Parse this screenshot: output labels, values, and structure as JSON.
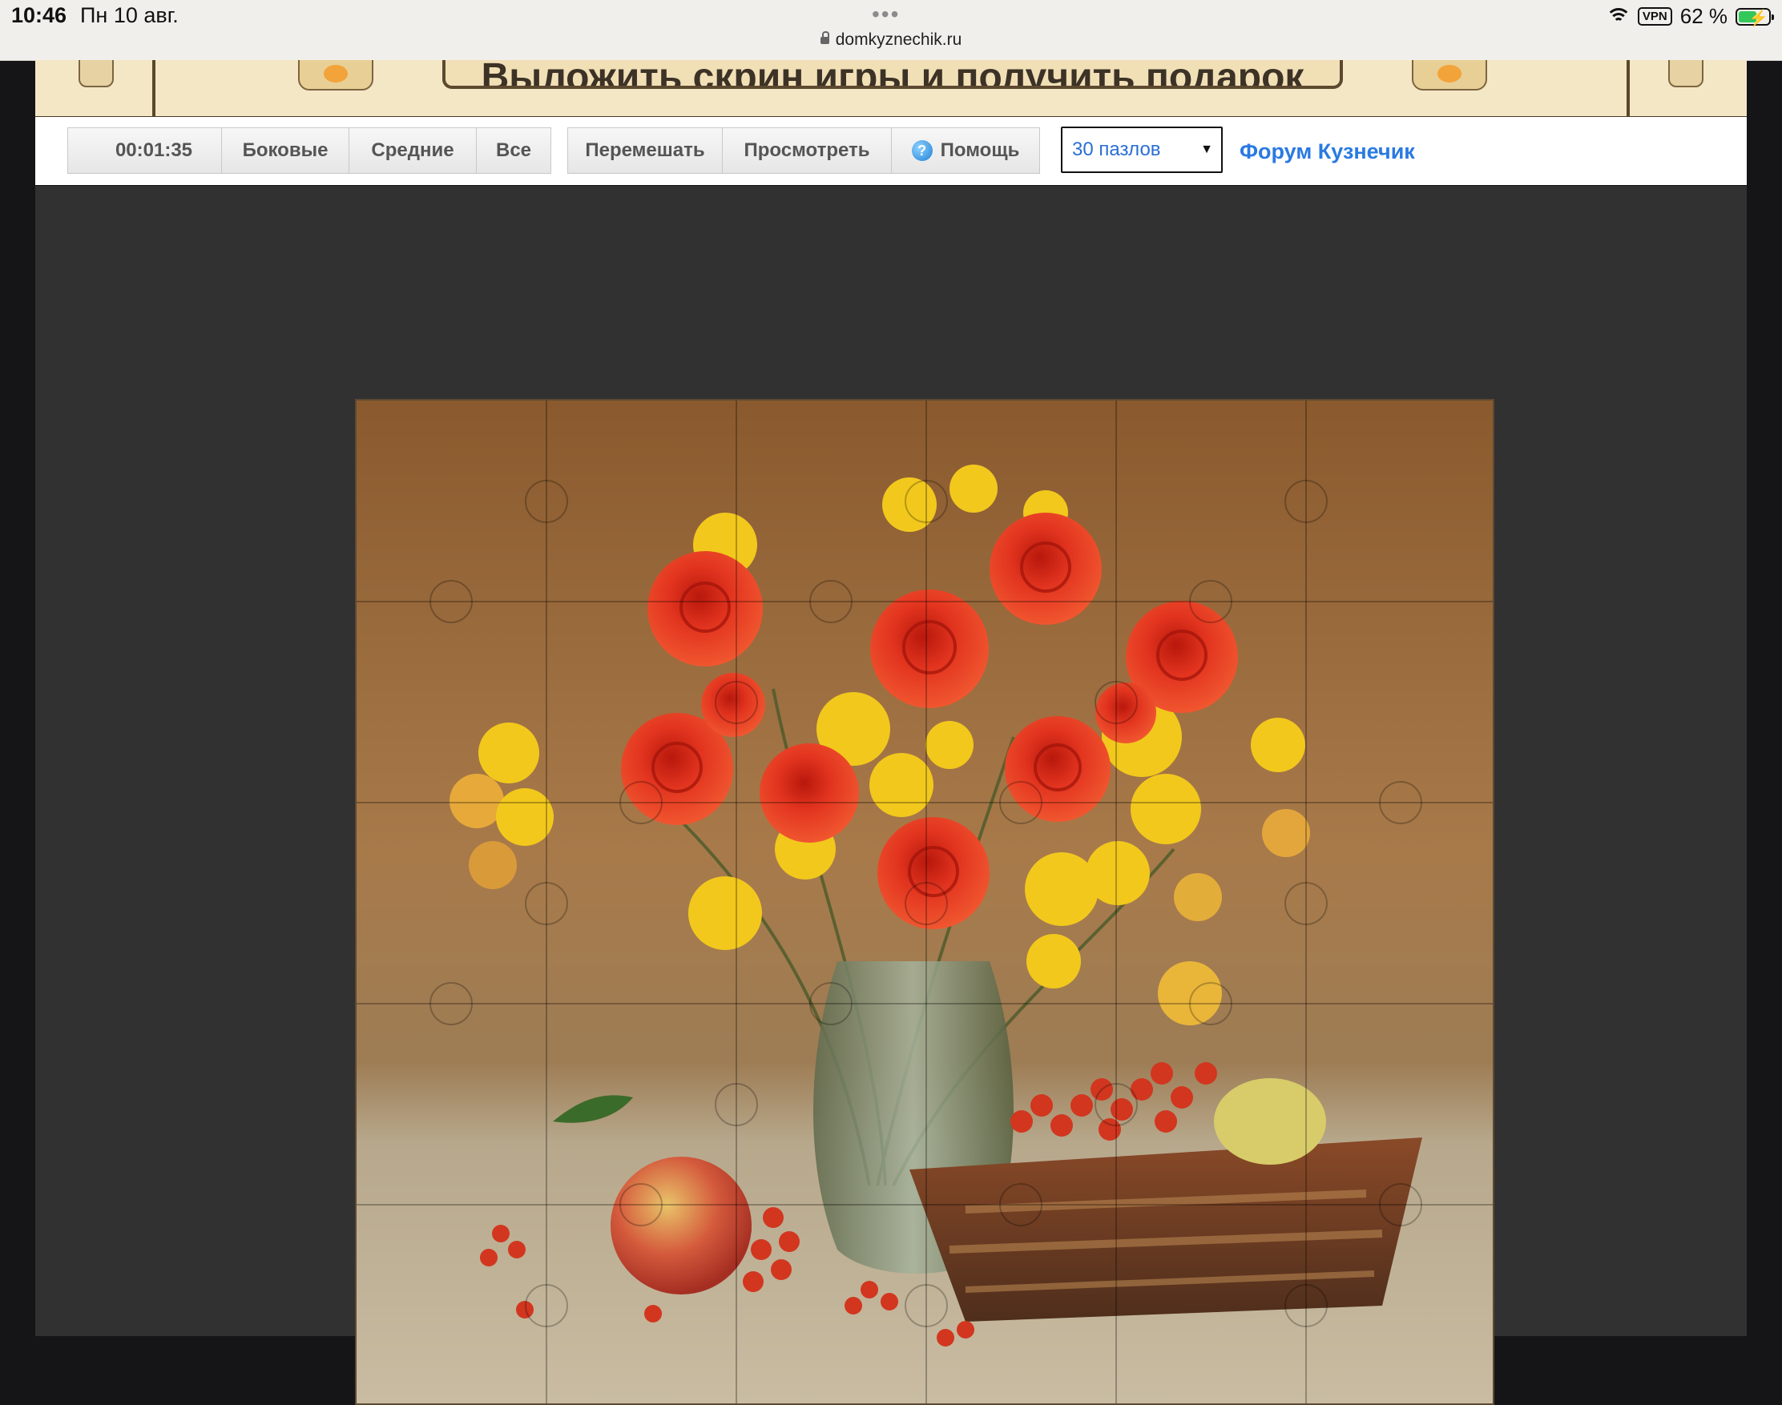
{
  "status_bar": {
    "time": "10:46",
    "date": "Пн 10 авг.",
    "url": "domkyznechik.ru",
    "vpn": "VPN",
    "battery": "62 %"
  },
  "banner": {
    "title": "Выложить скрин игры и получить подарок"
  },
  "toolbar": {
    "timer": "00:01:35",
    "btn_edges": "Боковые",
    "btn_middle": "Средние",
    "btn_all": "Все",
    "btn_shuffle": "Перемешать",
    "btn_preview": "Просмотреть",
    "btn_help": "Помощь",
    "pieces_select": "30 пазлов",
    "forum_link": "Форум Кузнечик"
  },
  "colors": {
    "accent_link": "#2a7ae2",
    "rose": "#e2341f",
    "chrysanthemum": "#f2c81d"
  },
  "puzzle": {
    "cols": 6,
    "rows": 5
  }
}
